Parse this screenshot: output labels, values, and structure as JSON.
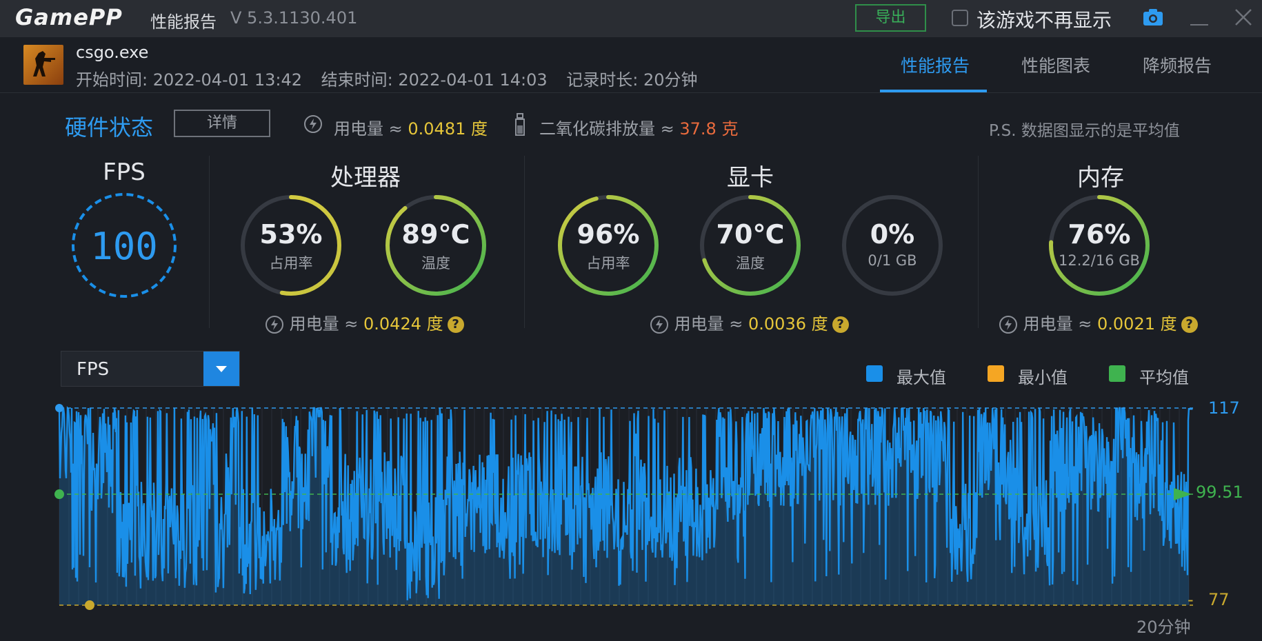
{
  "titlebar": {
    "logo": "GamePP",
    "app_title": "性能报告",
    "version": "V 5.3.1130.401",
    "export_label": "导出",
    "hide_label": "该游戏不再显示"
  },
  "game": {
    "exe": "csgo.exe",
    "start_time": "开始时间: 2022-04-01 13:42",
    "end_time": "结束时间: 2022-04-01 14:03",
    "duration": "记录时长: 20分钟"
  },
  "tabs": [
    "性能报告",
    "性能图表",
    "降频报告"
  ],
  "hardware": {
    "title": "硬件状态",
    "detail_label": "详情",
    "total_power_label": "用电量 ≈ ",
    "total_power_value": "0.0481 度",
    "co2_label": "二氧化碳排放量 ≈ ",
    "co2_value": "37.8 克",
    "note": "P.S. 数据图显示的是平均值"
  },
  "sections": {
    "fps": {
      "title": "FPS",
      "value": "100"
    },
    "cpu": {
      "title": "处理器",
      "usage": {
        "value": "53%",
        "label": "占用率",
        "fraction": 0.53
      },
      "temp": {
        "value": "89℃",
        "label": "温度",
        "fraction": 0.89
      },
      "power_label": "用电量 ≈ ",
      "power_value": "0.0424 度"
    },
    "gpu": {
      "title": "显卡",
      "usage": {
        "value": "96%",
        "label": "占用率",
        "fraction": 0.96
      },
      "temp": {
        "value": "70℃",
        "label": "温度",
        "fraction": 0.7
      },
      "vram": {
        "value": "0%",
        "label": "0/1 GB",
        "fraction": 0.0
      },
      "power_label": "用电量 ≈ ",
      "power_value": "0.0036 度"
    },
    "memory": {
      "title": "内存",
      "usage": {
        "value": "76%",
        "label": "12.2/16 GB",
        "fraction": 0.76
      },
      "power_label": "用电量 ≈ ",
      "power_value": "0.0021 度"
    }
  },
  "chart_controls": {
    "metric": "FPS",
    "legend": [
      {
        "label": "最大值",
        "color": "#1a8fe8"
      },
      {
        "label": "最小值",
        "color": "#f5a623"
      },
      {
        "label": "平均值",
        "color": "#3fb34f"
      }
    ]
  },
  "chart_data": {
    "type": "area",
    "series": [
      {
        "name": "FPS"
      }
    ],
    "max": 117,
    "min": 77,
    "avg": 99.51,
    "max_label": "117",
    "min_label": "77",
    "avg_label": "99.51",
    "x_end_label": "20分钟",
    "ylim": [
      77,
      117
    ]
  },
  "colors": {
    "accent": "#2e9bf0",
    "max": "#1a8fe8",
    "min": "#c9a92e",
    "avg": "#3fb34f"
  }
}
